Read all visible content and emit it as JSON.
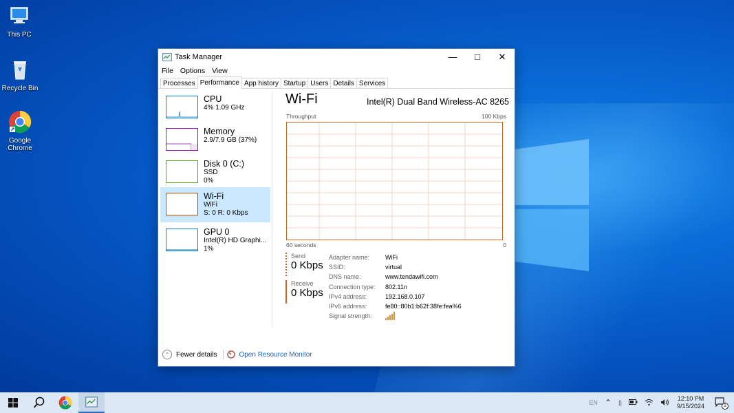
{
  "desktop": {
    "icons": [
      {
        "label": "This PC"
      },
      {
        "label": "Recycle Bin"
      },
      {
        "label": "Google Chrome"
      }
    ]
  },
  "window": {
    "title": "Task Manager",
    "menu": [
      "File",
      "Options",
      "View"
    ],
    "tabs": [
      "Processes",
      "Performance",
      "App history",
      "Startup",
      "Users",
      "Details",
      "Services"
    ],
    "active_tab": "Performance"
  },
  "sidebar": [
    {
      "name": "CPU",
      "line1": "4%  1.09 GHz",
      "line2": "",
      "color": "#117dbb"
    },
    {
      "name": "Memory",
      "line1": "2.9/7.9 GB (37%)",
      "line2": "",
      "color": "#8b12ae"
    },
    {
      "name": "Disk 0 (C:)",
      "line1": "SSD",
      "line2": "0%",
      "color": "#4da60c"
    },
    {
      "name": "Wi-Fi",
      "line1": "WiFi",
      "line2": "S: 0  R: 0 Kbps",
      "color": "#a74f01",
      "selected": true
    },
    {
      "name": "GPU 0",
      "line1": "Intel(R) HD Graphi...",
      "line2": "1%",
      "color": "#117dbb"
    }
  ],
  "detail": {
    "title": "Wi-Fi",
    "adapter": "Intel(R) Dual Band Wireless-AC 8265",
    "graph_label": "Throughput",
    "graph_max": "100 Kbps",
    "graph_time": "60 seconds",
    "graph_min": "0",
    "send_label": "Send",
    "send_value": "0 Kbps",
    "receive_label": "Receive",
    "receive_value": "0 Kbps",
    "properties": [
      {
        "key": "Adapter name:",
        "value": "WiFi"
      },
      {
        "key": "SSID:",
        "value": "virtual"
      },
      {
        "key": "DNS name:",
        "value": "www.tendawifi.com"
      },
      {
        "key": "Connection type:",
        "value": "802.11n"
      },
      {
        "key": "IPv4 address:",
        "value": "192.168.0.107"
      },
      {
        "key": "IPv6 address:",
        "value": "fe80::80b1:b62f:38fe:fea%6"
      },
      {
        "key": "Signal strength:",
        "value": ""
      }
    ]
  },
  "footer": {
    "fewer_details": "Fewer details",
    "resource_monitor": "Open Resource Monitor"
  },
  "taskbar": {
    "lang": "EN",
    "time": "12:10 PM",
    "date": "9/15/2024",
    "notification_count": "1"
  },
  "colors": {
    "accent": "#0a6ed8",
    "wifi": "#c9672a",
    "link": "#1a64c8"
  }
}
